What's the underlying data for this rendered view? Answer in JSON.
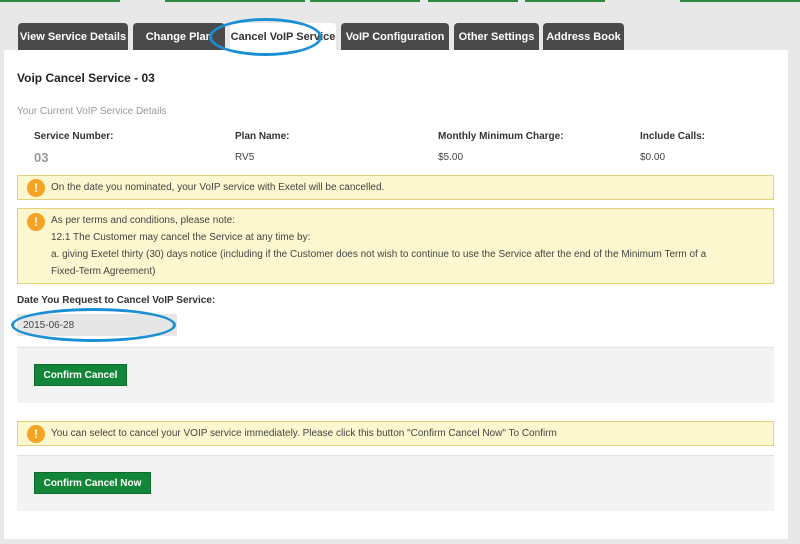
{
  "tabs": [
    {
      "label": "View Service Details"
    },
    {
      "label": "Change Plan"
    },
    {
      "label": "Cancel VoIP Service"
    },
    {
      "label": "VoIP Configuration"
    },
    {
      "label": "Other Settings"
    },
    {
      "label": "Address Book"
    }
  ],
  "active_tab": "Cancel VoIP Service",
  "page": {
    "title": "Voip Cancel Service - 03",
    "subtitle": "Your Current VoIP Service Details"
  },
  "service_details": {
    "headers": [
      "Service Number:",
      "Plan Name:",
      "Monthly Minimum Charge:",
      "Include Calls:"
    ],
    "values": [
      "03",
      "RV5",
      "$5.00",
      "$0.00"
    ]
  },
  "alerts": {
    "cancel_notice": "On the date you nominated, your VoIP service with Exetel will be cancelled.",
    "terms": {
      "line1": "As per terms and conditions, please note:",
      "line2": "12.1 The Customer may cancel the Service at any time by:",
      "line3": "a. giving Exetel thirty (30) days notice (including if the Customer does not wish to continue to use the Service after the end of the Minimum Term of a",
      "line4": "Fixed-Term Agreement)"
    },
    "immediate": "You can select to cancel your VOIP service immediately. Please click this button \"Confirm Cancel Now\" To Confirm"
  },
  "cancel_form": {
    "date_label": "Date You Request to Cancel VoIP Service:",
    "date_value": "2015-06-28",
    "confirm_label": "Confirm Cancel",
    "confirm_now_label": "Confirm Cancel Now"
  },
  "colors": {
    "accent_green": "#138538",
    "tab_dark": "#4a4a4a",
    "highlight_blue": "#1a8fd4",
    "alert_bg": "#fdf7cf",
    "alert_icon": "#f4a322"
  },
  "icons": {
    "alert": "warning-circle-icon"
  }
}
